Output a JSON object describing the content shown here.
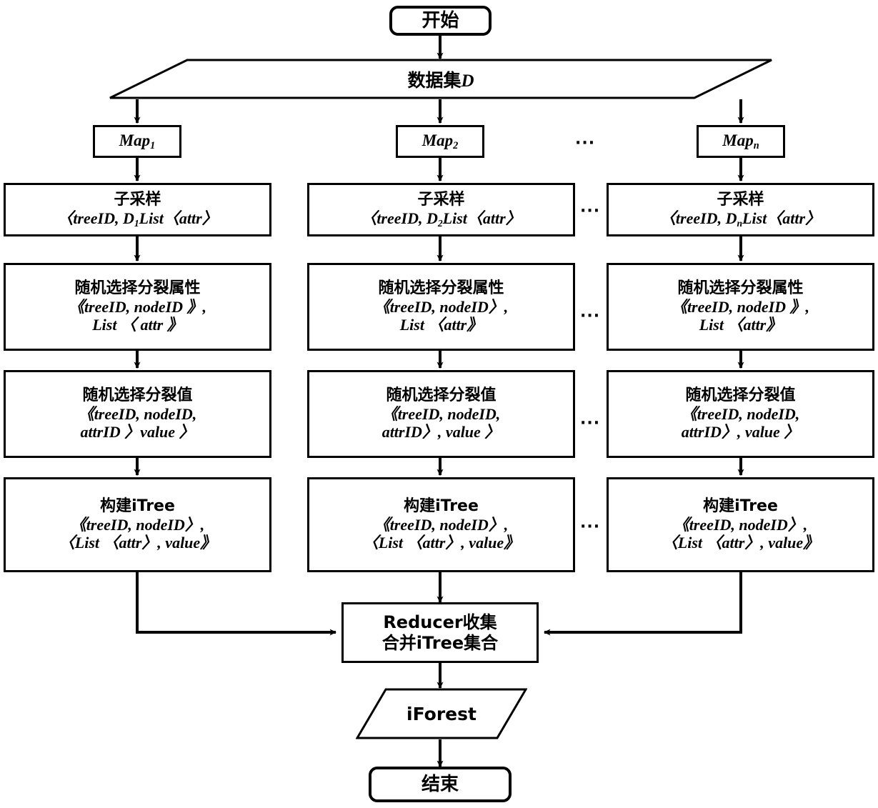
{
  "diagram": {
    "title": "MapReduce iForest 构建流程图",
    "type": "flowchart",
    "ink_color": "#000000",
    "background_color": "#ffffff",
    "ellipsis": "···"
  },
  "start": {
    "label": "开始"
  },
  "dataset": {
    "label_cn": "数据集",
    "label_var": "D"
  },
  "mappers": [
    {
      "name": "Map",
      "subscript": "1"
    },
    {
      "name": "Map",
      "subscript": "2"
    },
    {
      "name": "Map",
      "subscript": "n"
    }
  ],
  "columns": [
    {
      "id": "col-1",
      "subsample": {
        "title": "子采样",
        "line2_pre": "〈treeID, D",
        "line2_sub": "1",
        "line2_post": "List〈attr〉"
      },
      "split_attr": {
        "title": "随机选择分裂属性",
        "line2": "《treeID, nodeID 》,",
        "line3": "List 〈 attr 》"
      },
      "split_value": {
        "title": "随机选择分裂值",
        "line2": "《treeID, nodeID,",
        "line3": "attrID 〉value 〉"
      },
      "build_itree": {
        "title": "构建iTree",
        "line2": "《treeID, nodeID〉,",
        "line3": "〈List 〈attr〉, value》"
      }
    },
    {
      "id": "col-2",
      "subsample": {
        "title": "子采样",
        "line2_pre": "〈treeID, D",
        "line2_sub": "2",
        "line2_post": "List〈attr〉"
      },
      "split_attr": {
        "title": "随机选择分裂属性",
        "line2": "《treeID, nodeID〉,",
        "line3": "List 〈attr》"
      },
      "split_value": {
        "title": "随机选择分裂值",
        "line2": "《treeID, nodeID,",
        "line3": "attrID〉, value 〉"
      },
      "build_itree": {
        "title": "构建iTree",
        "line2": "《treeID, nodeID〉,",
        "line3": "〈List 〈attr〉, value》"
      }
    },
    {
      "id": "col-n",
      "subsample": {
        "title": "子采样",
        "line2_pre": "〈treeID, D",
        "line2_sub": "n",
        "line2_post": "List〈attr〉"
      },
      "split_attr": {
        "title": "随机选择分裂属性",
        "line2": "《treeID, nodeID 》,",
        "line3": "List 〈attr》"
      },
      "split_value": {
        "title": "随机选择分裂值",
        "line2": "《treeID, nodeID,",
        "line3": "attrID〉, value 〉"
      },
      "build_itree": {
        "title": "构建iTree",
        "line2": "《treeID, nodeID〉,",
        "line3": "〈List 〈attr〉, value》"
      }
    }
  ],
  "reducer": {
    "line1": "Reducer收集",
    "line2": "合并iTree集合"
  },
  "output": {
    "label": "iForest"
  },
  "end": {
    "label": "结束"
  }
}
